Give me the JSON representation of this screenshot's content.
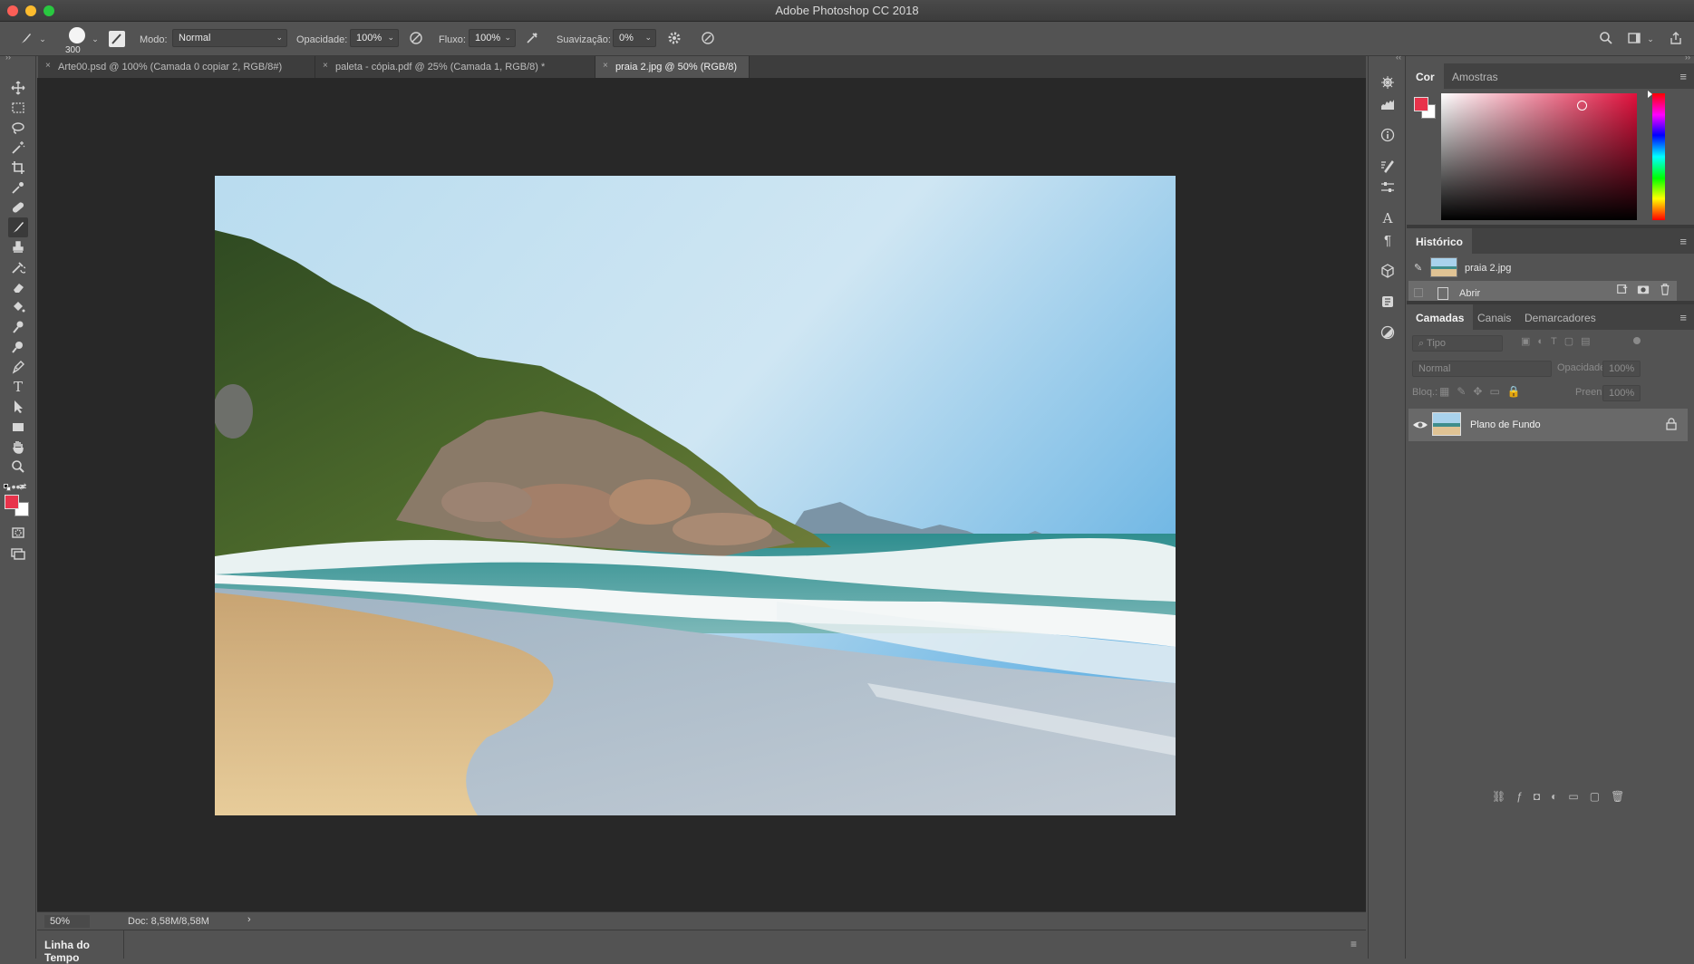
{
  "app": {
    "title": "Adobe Photoshop CC 2018"
  },
  "options": {
    "brush_size": "300",
    "mode_label": "Modo:",
    "mode_value": "Normal",
    "opacity_label": "Opacidade:",
    "opacity_value": "100%",
    "flow_label": "Fluxo:",
    "flow_value": "100%",
    "smoothing_label": "Suavização:",
    "smoothing_value": "0%"
  },
  "tabs": [
    {
      "label": "Arte00.psd @ 100% (Camada 0 copiar 2, RGB/8#)",
      "active": false
    },
    {
      "label": "paleta - cópia.pdf @ 25% (Camada 1, RGB/8) *",
      "active": false
    },
    {
      "label": "praia 2.jpg @ 50% (RGB/8)",
      "active": true
    }
  ],
  "tools": [
    "move-icon",
    "marquee-icon",
    "lasso-icon",
    "magic-wand-icon",
    "crop-icon",
    "eyedropper-icon",
    "healing-icon",
    "brush-icon",
    "stamp-icon",
    "history-brush-icon",
    "eraser-icon",
    "paint-bucket-icon",
    "smudge-icon",
    "dodge-icon",
    "pen-icon",
    "type-icon",
    "path-select-icon",
    "rectangle-icon",
    "hand-icon",
    "zoom-icon",
    "more-icon"
  ],
  "colors": {
    "foreground": "#e8334b",
    "background": "#ffffff",
    "accent": "#e8334b"
  },
  "status": {
    "zoom": "50%",
    "doc": "Doc: 8,58M/8,58M",
    "arrow": "›"
  },
  "timeline": {
    "label": "Linha do Tempo"
  },
  "color_panel": {
    "tabs": [
      "Cor",
      "Amostras"
    ]
  },
  "history_panel": {
    "title": "Histórico",
    "snapshot": "praia 2.jpg",
    "items": [
      "Abrir"
    ]
  },
  "layers_panel": {
    "tabs": [
      "Camadas",
      "Canais",
      "Demarcadores"
    ],
    "filter_placeholder": "Tipo",
    "blend_mode": "Normal",
    "opacity_label": "Opacidade:",
    "opacity_value": "100%",
    "lock_label": "Bloq.:",
    "fill_label": "Preen.:",
    "fill_value": "100%",
    "layers": [
      {
        "name": "Plano de Fundo",
        "visible": true,
        "locked": true
      }
    ]
  }
}
